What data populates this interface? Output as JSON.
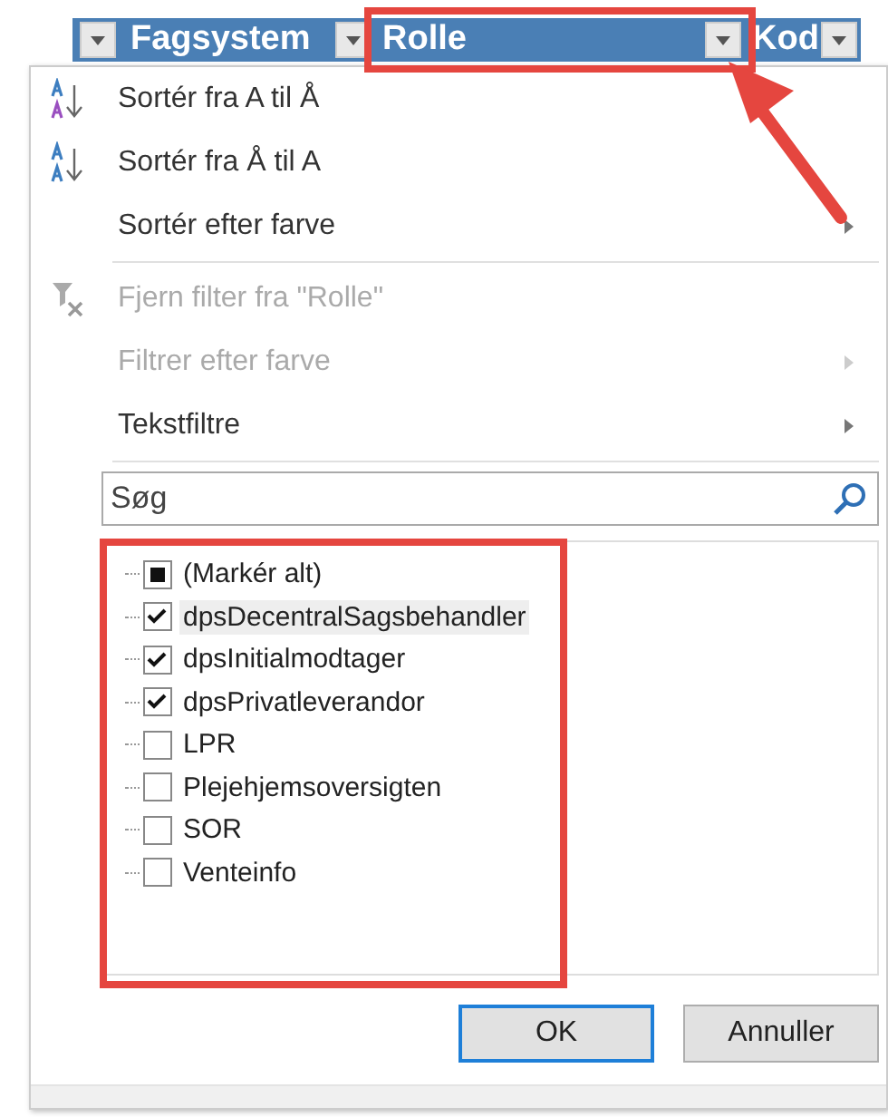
{
  "header": {
    "columns": [
      {
        "highlighted": false
      },
      {
        "label": "Fagsystem",
        "highlighted": false
      },
      {
        "label": "Rolle",
        "highlighted": true
      },
      {
        "label": "Kod",
        "highlighted": false
      }
    ]
  },
  "menu": {
    "items": [
      {
        "kind": "sort_asc",
        "label": "Sortér fra A til Å",
        "disabled": false,
        "submenu": false
      },
      {
        "kind": "sort_desc",
        "label": "Sortér fra Å til A",
        "disabled": false,
        "submenu": false
      },
      {
        "kind": "plain",
        "label": "Sortér efter farve",
        "disabled": false,
        "submenu": true
      },
      {
        "kind": "separator"
      },
      {
        "kind": "clear_filter",
        "label": "Fjern filter fra \"Rolle\"",
        "disabled": true,
        "submenu": false
      },
      {
        "kind": "plain",
        "label": "Filtrer efter farve",
        "disabled": true,
        "submenu": true
      },
      {
        "kind": "plain",
        "label": "Tekstfiltre",
        "disabled": false,
        "submenu": true
      },
      {
        "kind": "separator"
      }
    ],
    "search": {
      "placeholder": "Søg"
    },
    "values": [
      {
        "label": "(Markér alt)",
        "checked": false,
        "indeterminate": true,
        "selected": false
      },
      {
        "label": "dpsDecentralSagsbehandler",
        "checked": true,
        "indeterminate": false,
        "selected": true
      },
      {
        "label": "dpsInitialmodtager",
        "checked": true,
        "indeterminate": false,
        "selected": false
      },
      {
        "label": "dpsPrivatleverandor",
        "checked": true,
        "indeterminate": false,
        "selected": false
      },
      {
        "label": "LPR",
        "checked": false,
        "indeterminate": false,
        "selected": false
      },
      {
        "label": "Plejehjemsoversigten",
        "checked": false,
        "indeterminate": false,
        "selected": false
      },
      {
        "label": "SOR",
        "checked": false,
        "indeterminate": false,
        "selected": false
      },
      {
        "label": "Venteinfo",
        "checked": false,
        "indeterminate": false,
        "selected": false
      }
    ],
    "buttons": [
      {
        "label": "OK",
        "default": true
      },
      {
        "label": "Annuller",
        "default": false
      }
    ]
  }
}
